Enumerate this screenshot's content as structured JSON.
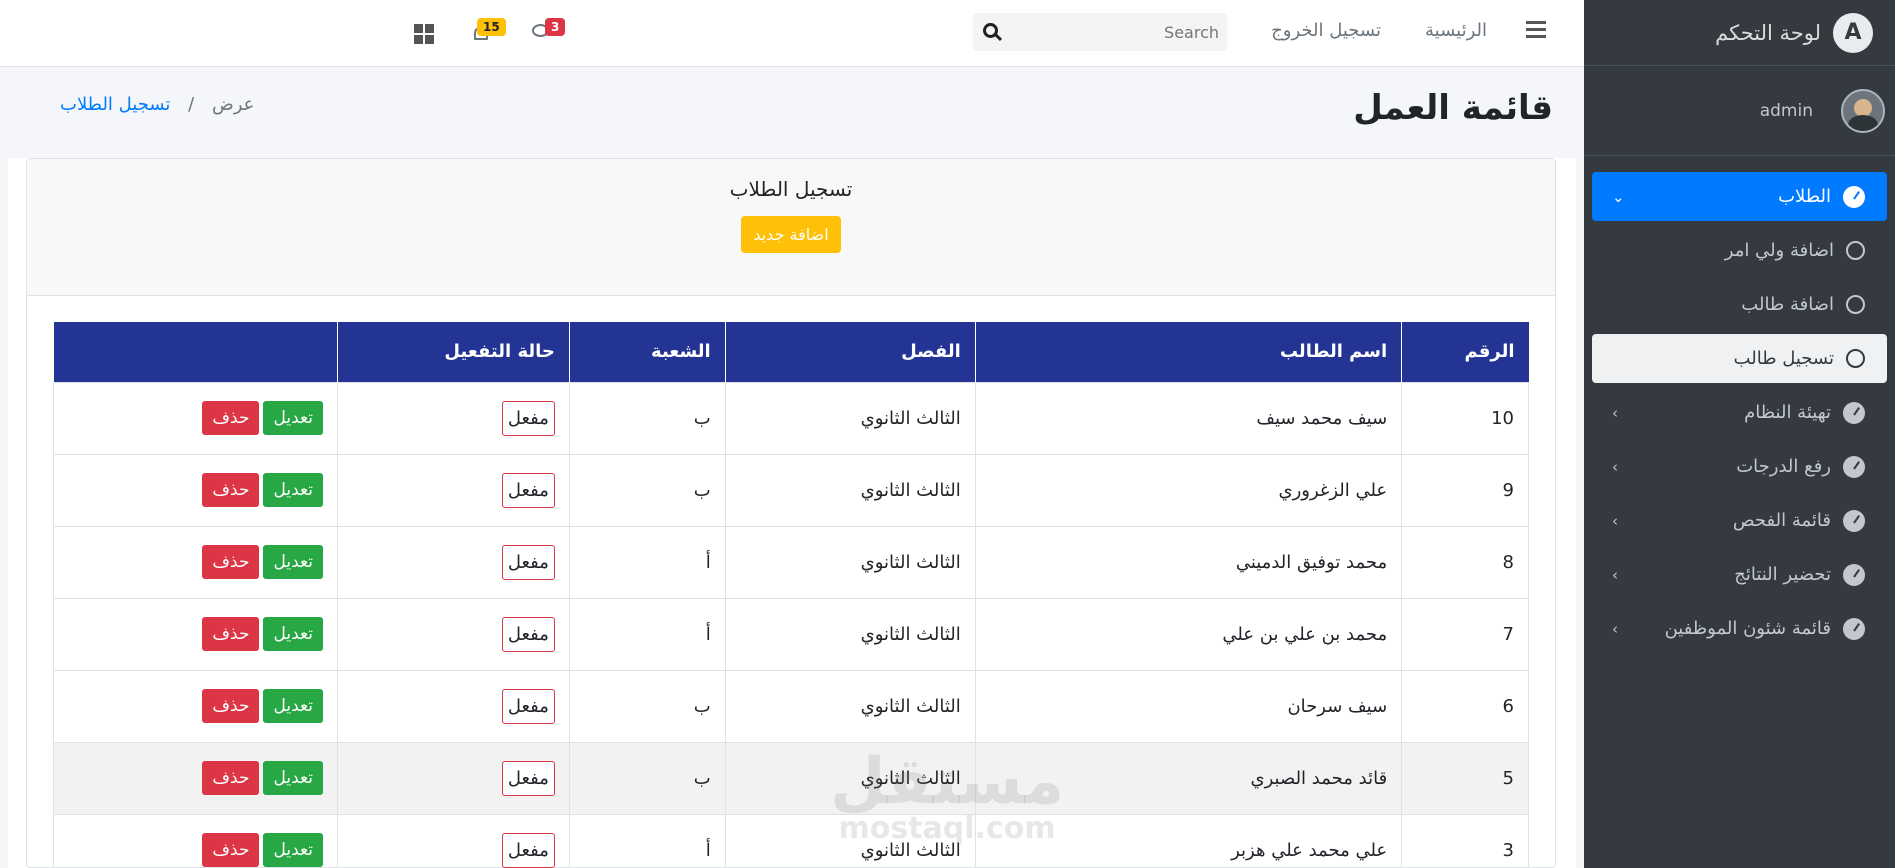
{
  "sidebar": {
    "brand_logo": "A",
    "brand_title": "لوحة التحكم",
    "user_name": "admin",
    "items": [
      {
        "label": "الطلاب",
        "icon": "gauge-icon",
        "state": "active",
        "chevron": "⌄"
      },
      {
        "label": "اضافة ولي امر",
        "icon": "circle-icon",
        "state": "normal",
        "chevron": ""
      },
      {
        "label": "اضافة طالب",
        "icon": "circle-icon",
        "state": "normal",
        "chevron": ""
      },
      {
        "label": "تسجيل طالب",
        "icon": "circle-icon",
        "state": "selected",
        "chevron": ""
      },
      {
        "label": "تهيئة النظام",
        "icon": "gauge-icon",
        "state": "normal",
        "chevron": "‹"
      },
      {
        "label": "رفع الدرجات",
        "icon": "gauge-icon",
        "state": "normal",
        "chevron": "‹"
      },
      {
        "label": "قائمة الفحص",
        "icon": "gauge-icon",
        "state": "normal",
        "chevron": "‹"
      },
      {
        "label": "تحضير النتائج",
        "icon": "gauge-icon",
        "state": "normal",
        "chevron": "‹"
      },
      {
        "label": "قائمة شئون الموظفين",
        "icon": "gauge-icon",
        "state": "normal",
        "chevron": "‹"
      }
    ]
  },
  "topbar": {
    "home_label": "الرئيسية",
    "logout_label": "تسجيل الخروج",
    "search_placeholder": "Search",
    "messages_count": "3",
    "notifications_count": "15"
  },
  "page": {
    "title": "قائمة العمل",
    "breadcrumb_link": "تسجيل الطلاب",
    "breadcrumb_separator": "/",
    "breadcrumb_current": "عرض"
  },
  "card": {
    "title": "تسجيل الطلاب",
    "add_label": "اضافة جديد"
  },
  "table": {
    "headers": [
      "الرقم",
      "اسم الطالب",
      "الفصل",
      "الشعبة",
      "حالة التفعيل",
      ""
    ],
    "edit_label": "تعديل",
    "delete_label": "حذف",
    "rows": [
      {
        "id": "10",
        "name": "سيف محمد سيف",
        "class": "الثالث الثانوي",
        "section": "ب",
        "status": "مفعل"
      },
      {
        "id": "9",
        "name": "علي الزغروري",
        "class": "الثالث الثانوي",
        "section": "ب",
        "status": "مفعل"
      },
      {
        "id": "8",
        "name": "محمد توفيق الدميني",
        "class": "الثالث الثانوي",
        "section": "أ",
        "status": "مفعل"
      },
      {
        "id": "7",
        "name": "محمد بن علي بن علي",
        "class": "الثالث الثانوي",
        "section": "أ",
        "status": "مفعل"
      },
      {
        "id": "6",
        "name": "سيف سرحان",
        "class": "الثالث الثانوي",
        "section": "ب",
        "status": "مفعل"
      },
      {
        "id": "5",
        "name": "قائد محمد الصبري",
        "class": "الثالث الثانوي",
        "section": "ب",
        "status": "مفعل"
      },
      {
        "id": "3",
        "name": "علي محمد علي هزبر",
        "class": "الثالث الثانوي",
        "section": "أ",
        "status": "مفعل"
      }
    ]
  },
  "watermark": {
    "arabic": "مستقل",
    "latin": "mostaql.com"
  },
  "colors": {
    "primary": "#007bff",
    "header_bg": "#233494",
    "warning": "#ffc107",
    "success": "#28a745",
    "danger": "#dc3545",
    "sidebar_bg": "#343a40"
  }
}
